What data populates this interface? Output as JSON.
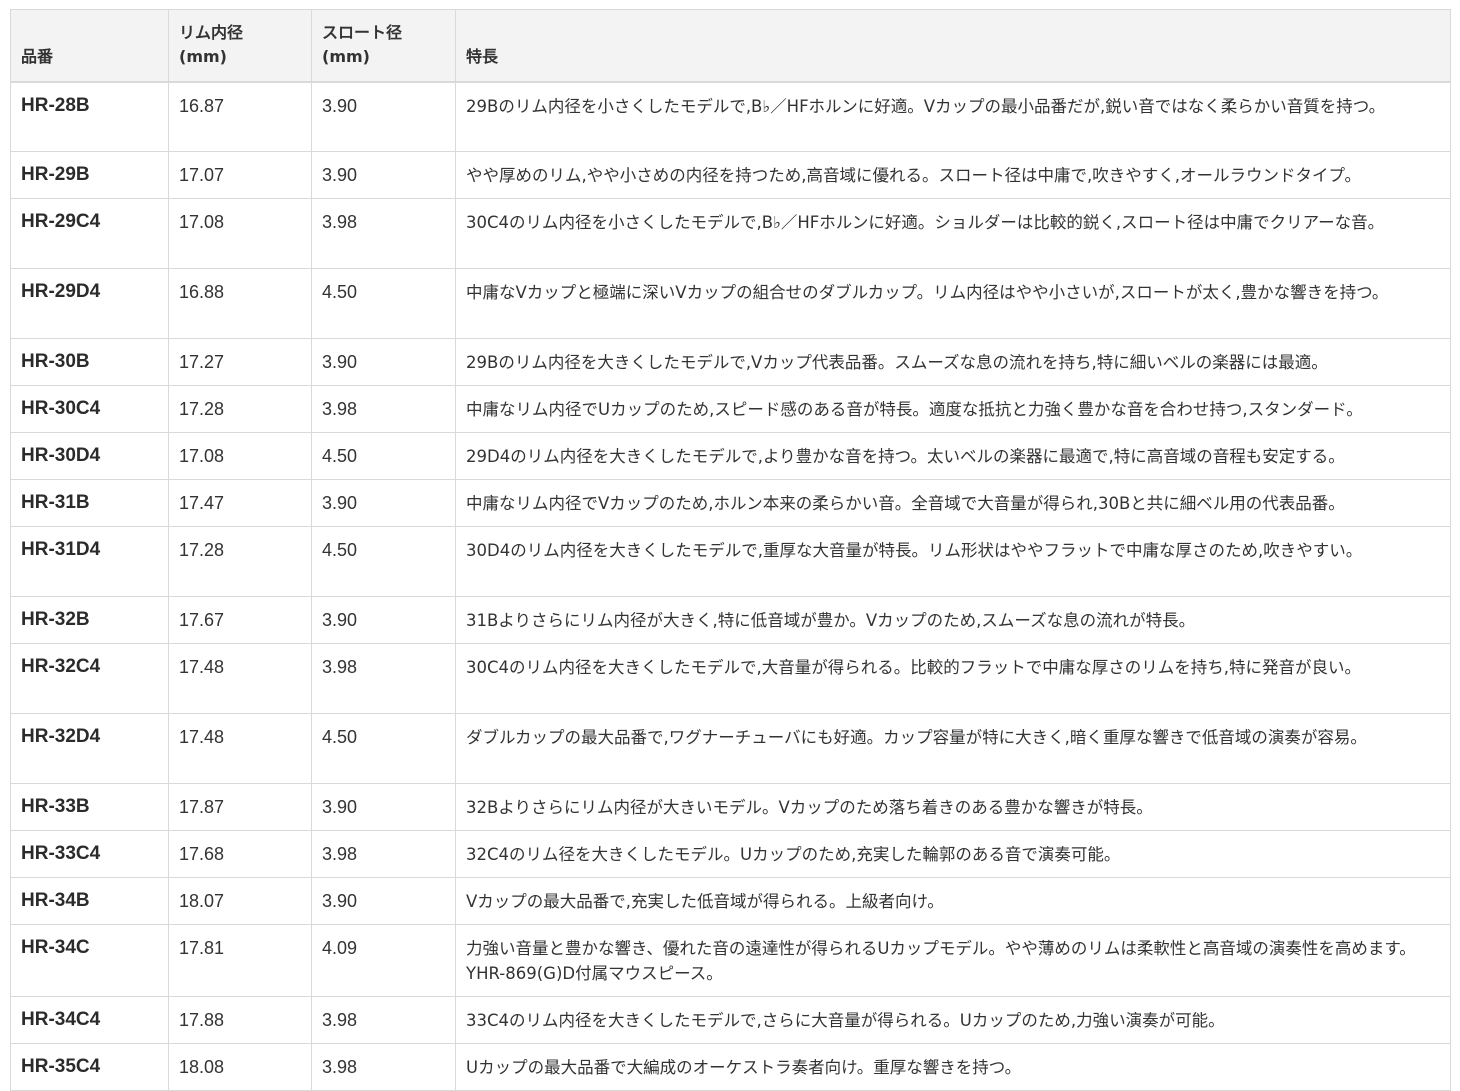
{
  "headers": {
    "model": "品番",
    "rim": "リム内径\n(mm)",
    "throat": "スロート径\n(mm)",
    "feature": "特長"
  },
  "rows": [
    {
      "model": "HR-28B",
      "rim": "16.87",
      "throat": "3.90",
      "feature": "29Bのリム内径を小さくしたモデルで,B♭／HFホルンに好適。Vカップの最小品番だが,鋭い音ではなく柔らかい音質を持つ。"
    },
    {
      "model": "HR-29B",
      "rim": "17.07",
      "throat": "3.90",
      "feature": "やや厚めのリム,やや小さめの内径を持つため,高音域に優れる。スロート径は中庸で,吹きやすく,オールラウンドタイプ。"
    },
    {
      "model": "HR-29C4",
      "rim": "17.08",
      "throat": "3.98",
      "feature": "30C4のリム内径を小さくしたモデルで,B♭／HFホルンに好適。ショルダーは比較的鋭く,スロート径は中庸でクリアーな音。"
    },
    {
      "model": "HR-29D4",
      "rim": "16.88",
      "throat": "4.50",
      "feature": "中庸なVカップと極端に深いVカップの組合せのダブルカップ。リム内径はやや小さいが,スロートが太く,豊かな響きを持つ。"
    },
    {
      "model": "HR-30B",
      "rim": "17.27",
      "throat": "3.90",
      "feature": "29Bのリム内径を大きくしたモデルで,Vカップ代表品番。スムーズな息の流れを持ち,特に細いベルの楽器には最適。"
    },
    {
      "model": "HR-30C4",
      "rim": "17.28",
      "throat": "3.98",
      "feature": "中庸なリム内径でUカップのため,スピード感のある音が特長。適度な抵抗と力強く豊かな音を合わせ持つ,スタンダード。"
    },
    {
      "model": "HR-30D4",
      "rim": "17.08",
      "throat": "4.50",
      "feature": "29D4のリム内径を大きくしたモデルで,より豊かな音を持つ。太いベルの楽器に最適で,特に高音域の音程も安定する。"
    },
    {
      "model": "HR-31B",
      "rim": "17.47",
      "throat": "3.90",
      "feature": "中庸なリム内径でVカップのため,ホルン本来の柔らかい音。全音域で大音量が得られ,30Bと共に細ベル用の代表品番。"
    },
    {
      "model": "HR-31D4",
      "rim": "17.28",
      "throat": "4.50",
      "feature": "30D4のリム内径を大きくしたモデルで,重厚な大音量が特長。リム形状はややフラットで中庸な厚さのため,吹きやすい。"
    },
    {
      "model": "HR-32B",
      "rim": "17.67",
      "throat": "3.90",
      "feature": "31Bよりさらにリム内径が大きく,特に低音域が豊か。Vカップのため,スムーズな息の流れが特長。"
    },
    {
      "model": "HR-32C4",
      "rim": "17.48",
      "throat": "3.98",
      "feature": "30C4のリム内径を大きくしたモデルで,大音量が得られる。比較的フラットで中庸な厚さのリムを持ち,特に発音が良い。"
    },
    {
      "model": "HR-32D4",
      "rim": "17.48",
      "throat": "4.50",
      "feature": "ダブルカップの最大品番で,ワグナーチューバにも好適。カップ容量が特に大きく,暗く重厚な響きで低音域の演奏が容易。"
    },
    {
      "model": "HR-33B",
      "rim": "17.87",
      "throat": "3.90",
      "feature": "32Bよりさらにリム内径が大きいモデル。Vカップのため落ち着きのある豊かな響きが特長。"
    },
    {
      "model": "HR-33C4",
      "rim": "17.68",
      "throat": "3.98",
      "feature": "32C4のリム径を大きくしたモデル。Uカップのため,充実した輪郭のある音で演奏可能。"
    },
    {
      "model": "HR-34B",
      "rim": "18.07",
      "throat": "3.90",
      "feature": "Vカップの最大品番で,充実した低音域が得られる。上級者向け。"
    },
    {
      "model": "HR-34C",
      "rim": "17.81",
      "throat": "4.09",
      "feature": "力強い音量と豊かな響き、優れた音の遠達性が得られるUカップモデル。やや薄めのリムは柔軟性と高音域の演奏性を高めます。YHR-869(G)D付属マウスピース。"
    },
    {
      "model": "HR-34C4",
      "rim": "17.88",
      "throat": "3.98",
      "feature": "33C4のリム内径を大きくしたモデルで,さらに大音量が得られる。Uカップのため,力強い演奏が可能。"
    },
    {
      "model": "HR-35C4",
      "rim": "18.08",
      "throat": "3.98",
      "feature": "Uカップの最大品番で大編成のオーケストラ奏者向け。重厚な響きを持つ。"
    }
  ]
}
